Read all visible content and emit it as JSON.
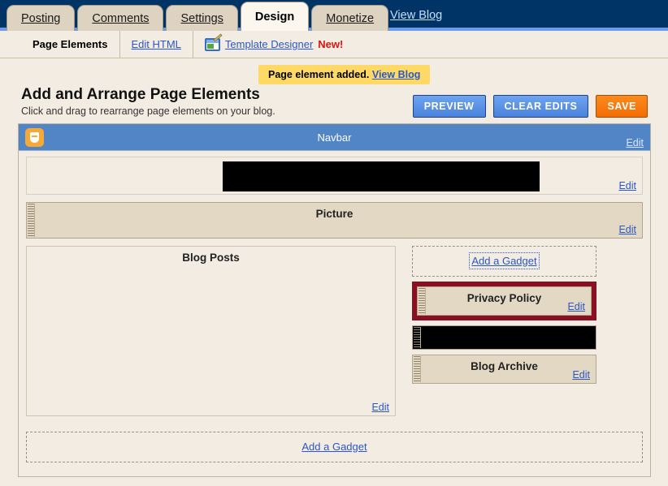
{
  "topnav": {
    "tabs": [
      {
        "label": "Posting",
        "active": false
      },
      {
        "label": "Comments",
        "active": false
      },
      {
        "label": "Settings",
        "active": false
      },
      {
        "label": "Design",
        "active": true
      },
      {
        "label": "Monetize",
        "active": false
      }
    ],
    "view_blog": "View Blog"
  },
  "subnav": {
    "page_elements": "Page Elements",
    "edit_html": "Edit HTML",
    "template_designer": "Template Designer",
    "new_badge": "New!"
  },
  "notice": {
    "message": "Page element added.",
    "link": "View Blog"
  },
  "heading": {
    "title": "Add and Arrange Page Elements",
    "subtitle": "Click and drag to rearrange page elements on your blog."
  },
  "actions": {
    "preview": "PREVIEW",
    "clear_edits": "CLEAR EDITS",
    "save": "SAVE"
  },
  "layout": {
    "navbar": {
      "title": "Navbar",
      "edit": "Edit"
    },
    "header": {
      "edit": "Edit"
    },
    "picture": {
      "title": "Picture",
      "edit": "Edit"
    },
    "blog_posts": {
      "title": "Blog Posts",
      "edit": "Edit"
    },
    "sidebar": {
      "add_gadget": "Add a Gadget",
      "privacy_policy": {
        "title": "Privacy Policy",
        "edit": "Edit"
      },
      "blog_archive": {
        "title": "Blog Archive",
        "edit": "Edit"
      }
    },
    "footer_add_gadget": "Add a Gadget"
  },
  "colors": {
    "header_navy": "#003366",
    "navbar_blue": "#5185c5",
    "accent_orange": "#f36d05",
    "button_blue": "#4a82dd",
    "notice_yellow": "#ffd966",
    "highlight_red": "#8b0f22",
    "link_blue": "#2b57c4",
    "page_bg": "#f3ece3",
    "gadget_tan": "#e2d8c3"
  }
}
